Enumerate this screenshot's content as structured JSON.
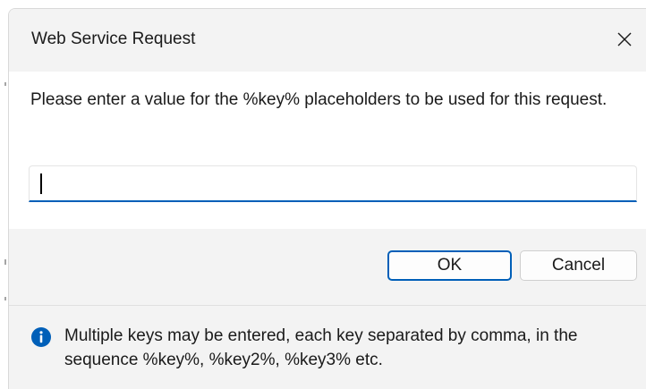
{
  "dialog": {
    "title": "Web Service Request",
    "close_icon": "close-icon",
    "prompt": "Please enter a value for the %key% placeholders to be used for this request.",
    "input": {
      "value": "",
      "placeholder": ""
    },
    "buttons": {
      "ok": "OK",
      "cancel": "Cancel"
    },
    "footer": {
      "icon": "info-icon",
      "text": "Multiple keys may be entered, each key separated by comma, in the sequence %key%, %key2%, %key3% etc."
    }
  },
  "colors": {
    "accent": "#005fb8",
    "chrome_background": "#f3f3f3",
    "content_background": "#ffffff"
  }
}
